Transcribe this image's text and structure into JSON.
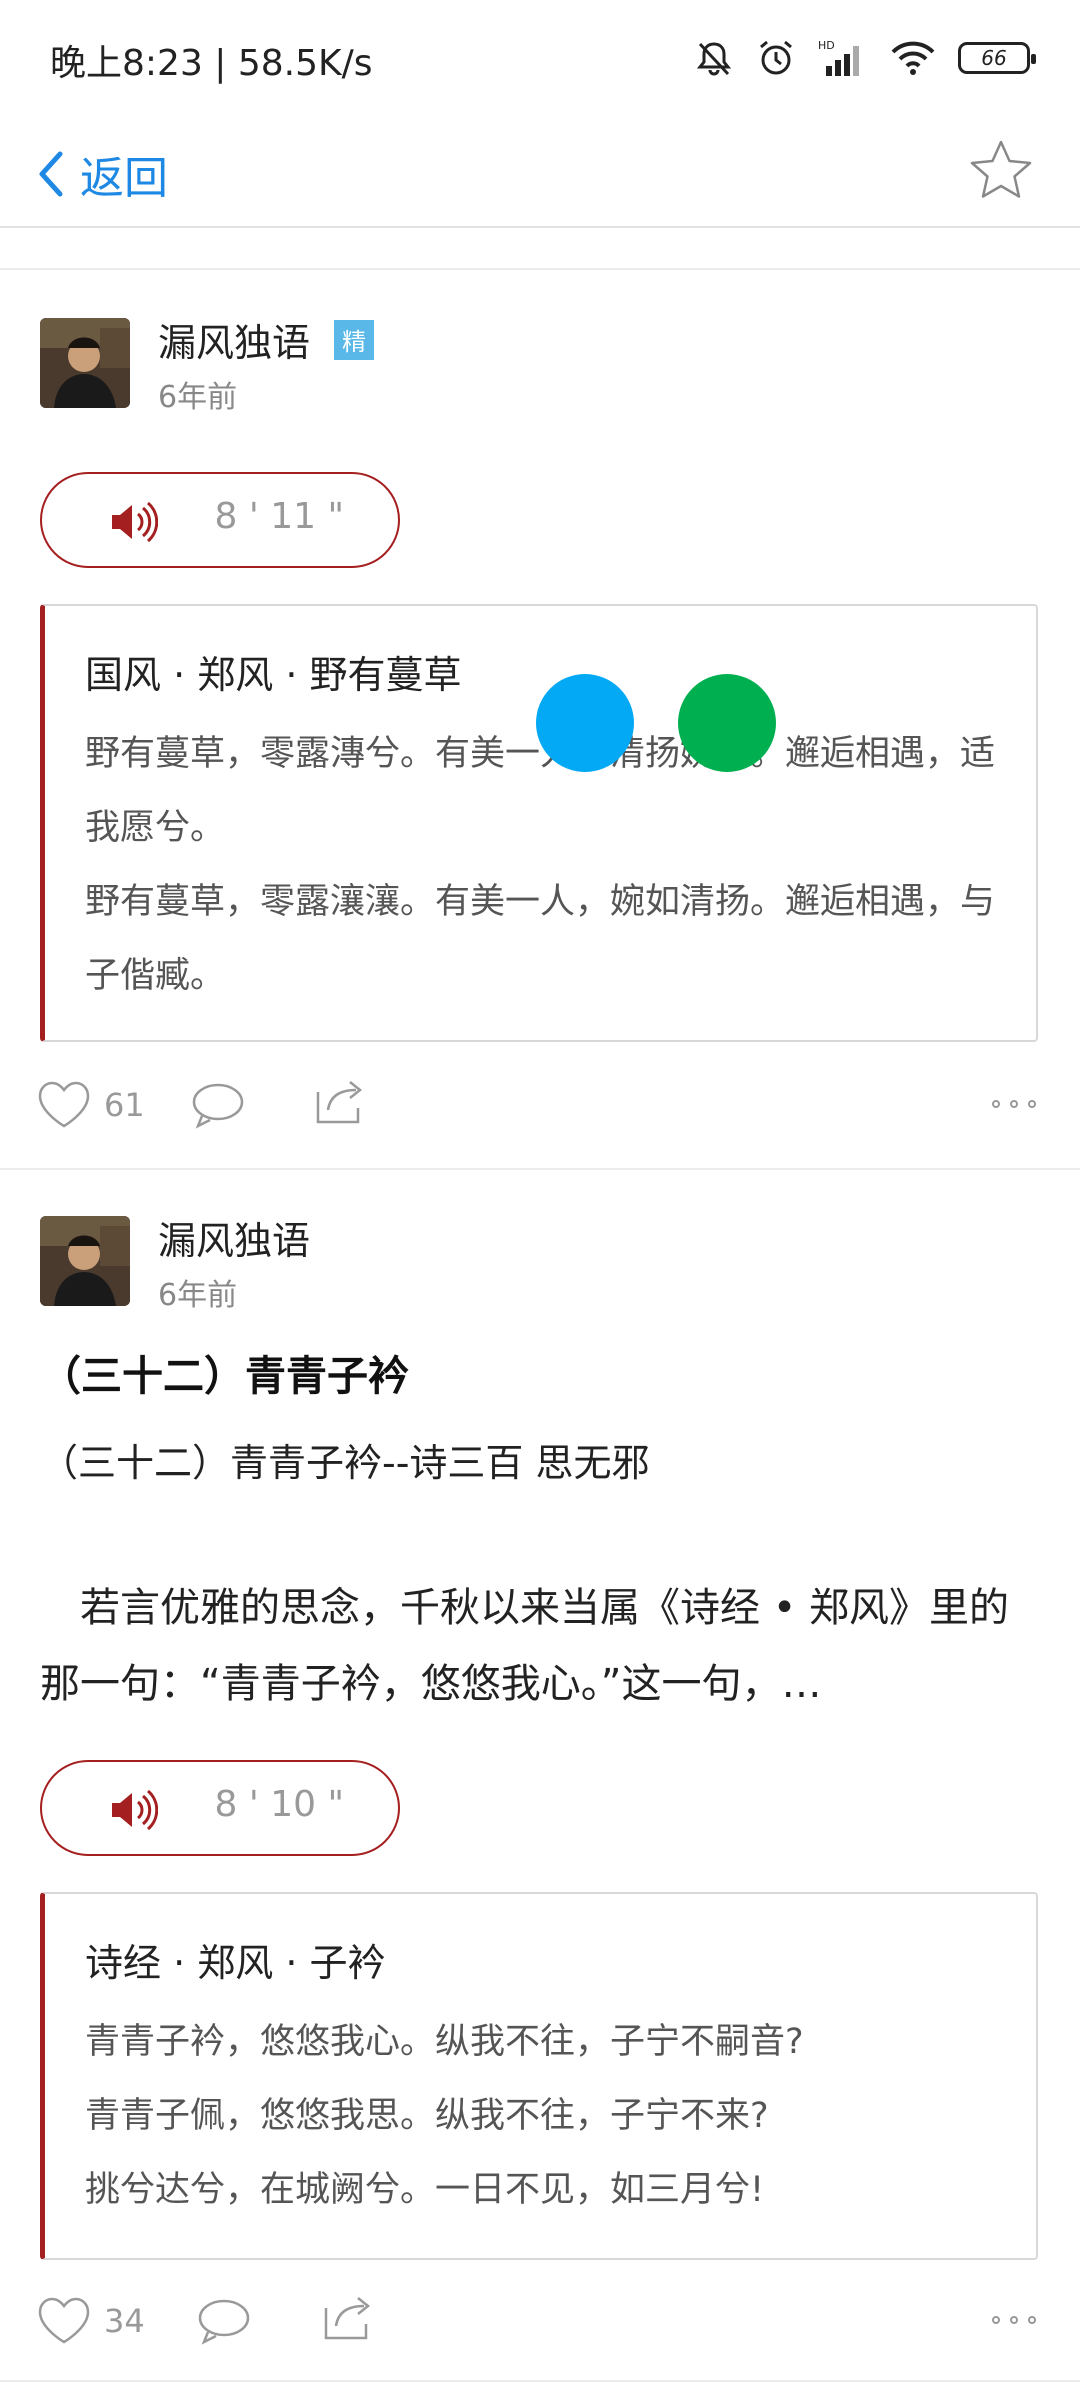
{
  "status_bar": {
    "time_speed": "晚上8:23 | 58.5K/s",
    "battery": "66"
  },
  "nav": {
    "back_label": "返回"
  },
  "posts": [
    {
      "author": "漏风独语",
      "badge": "精",
      "time": "6年前",
      "audio_duration": "8 ' 11 \"",
      "quote": {
        "title": "国风 · 郑风 · 野有蔓草",
        "lines": [
          "野有蔓草，零露漙兮。有美一人，清扬婉兮。邂逅相遇，适我愿兮。",
          "野有蔓草，零露瀼瀼。有美一人，婉如清扬。邂逅相遇，与子偕臧。"
        ]
      },
      "likes": "61"
    },
    {
      "author": "漏风独语",
      "time": "6年前",
      "article_title": "（三十二）青青子衿",
      "article_subtitle": "（三十二）青青子衿--诗三百 思无邪",
      "article_excerpt": "　若言优雅的思念，千秋以来当属《诗经 • 郑风》里的那一句：“青青子衿，悠悠我心。”这一句，…",
      "audio_duration": "8 ' 10 \"",
      "quote": {
        "title": "诗经 · 郑风 · 子衿",
        "lines": [
          "青青子衿，悠悠我心。纵我不往，子宁不嗣音?",
          "青青子佩，悠悠我思。纵我不往，子宁不来?",
          "挑兮达兮，在城阙兮。一日不见，如三月兮!"
        ]
      },
      "likes": "34"
    }
  ],
  "colors": {
    "accent_blue": "#1e88e5",
    "audio_red": "#a41f1f",
    "badge_blue": "#5ab8e8",
    "overlay_blue": "#03a9f4",
    "overlay_green": "#00b050"
  }
}
